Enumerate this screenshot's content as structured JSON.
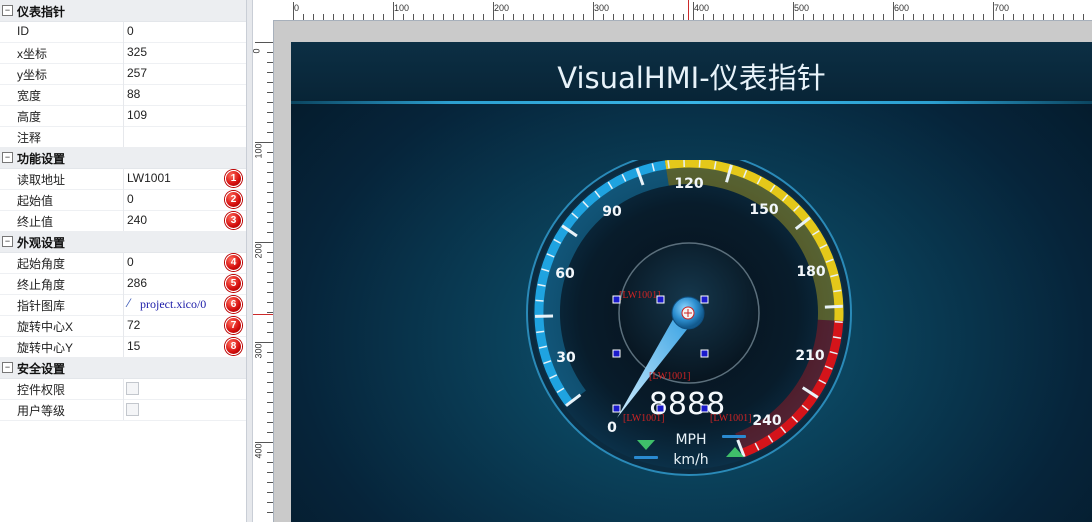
{
  "groups": [
    {
      "title": "仪表指针",
      "toggle": "⊟"
    },
    {
      "title": "功能设置",
      "toggle": "⊟"
    },
    {
      "title": "外观设置",
      "toggle": "⊟"
    },
    {
      "title": "安全设置",
      "toggle": "⊟"
    }
  ],
  "basic": [
    {
      "key": "ID",
      "value": "0"
    },
    {
      "key": "x坐标",
      "value": "325"
    },
    {
      "key": "y坐标",
      "value": "257"
    },
    {
      "key": "宽度",
      "value": "88"
    },
    {
      "key": "高度",
      "value": "109"
    },
    {
      "key": "注释",
      "value": ""
    }
  ],
  "function": [
    {
      "key": "读取地址",
      "value": "LW1001",
      "badge": "1"
    },
    {
      "key": "起始值",
      "value": "0",
      "badge": "2"
    },
    {
      "key": "终止值",
      "value": "240",
      "badge": "3"
    }
  ],
  "appearance": [
    {
      "key": "起始角度",
      "value": "0",
      "badge": "4"
    },
    {
      "key": "终止角度",
      "value": "286",
      "badge": "5"
    },
    {
      "key": "指针图库",
      "value": "project.xico/0",
      "badge": "6"
    },
    {
      "key": "旋转中心X",
      "value": "72",
      "badge": "7"
    },
    {
      "key": "旋转中心Y",
      "value": "15",
      "badge": "8"
    }
  ],
  "security": [
    {
      "key": "控件权限",
      "value": ""
    },
    {
      "key": "用户等级",
      "value": ""
    }
  ],
  "ruler": {
    "top": [
      "0",
      "100",
      "200",
      "300",
      "400",
      "500",
      "600",
      "700"
    ],
    "left": [
      "0",
      "100",
      "200",
      "300",
      "400"
    ]
  },
  "screen": {
    "title": "VisualHMI-仪表指针",
    "gauge": {
      "ticks": [
        "0",
        "30",
        "60",
        "90",
        "120",
        "150",
        "180",
        "210",
        "240"
      ],
      "display": "8888",
      "unit_mph": "MPH",
      "unit_kmh": "km/h",
      "address_tag": "[LW1001]"
    }
  },
  "colors": {
    "screen_bg": "#06243a",
    "gauge_blue": "#1fa3e0",
    "gauge_yellow": "#e4c81a",
    "gauge_red": "#d4141a",
    "badge_red": "#d40d0d",
    "selection_handle": "#1a1acc"
  }
}
